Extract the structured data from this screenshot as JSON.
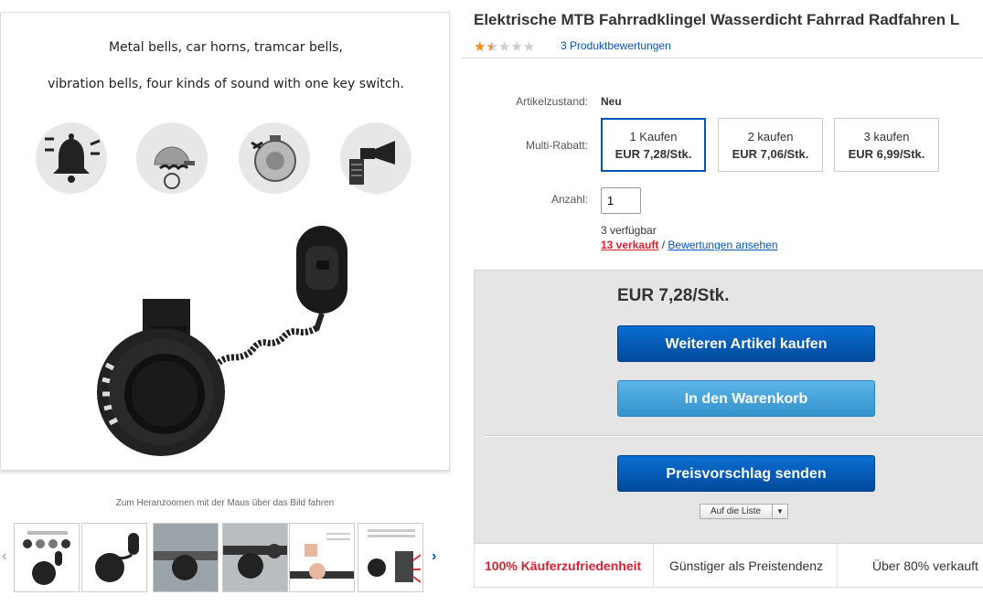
{
  "image_panel": {
    "caption_line1": "Metal bells, car horns, tramcar bells,",
    "caption_line2": "vibration bells, four kinds of sound with one key switch.",
    "zoom_hint": "Zum Heranzoomen mit der Maus über das Bild fahren",
    "thumbnail_count": 6
  },
  "product": {
    "title": "Elektrische MTB Fahrradklingel Wasserdicht Fahrrad Radfahren L",
    "rating_stars": 1.5,
    "rating_max": 5,
    "ratings_link": "3 Produktbewertungen"
  },
  "condition": {
    "label": "Artikelzustand:",
    "value": "Neu"
  },
  "multi_rabatt": {
    "label": "Multi-Rabatt:",
    "options": [
      {
        "qty": "1 Kaufen",
        "price": "EUR 7,28/Stk.",
        "selected": true
      },
      {
        "qty": "2 kaufen",
        "price": "EUR 7,06/Stk.",
        "selected": false
      },
      {
        "qty": "3 kaufen",
        "price": "EUR 6,99/Stk.",
        "selected": false
      }
    ]
  },
  "quantity": {
    "label": "Anzahl:",
    "value": "1",
    "available": "3 verfügbar",
    "sold": "13 verkauft",
    "separator": "/",
    "reviews_link": "Bewertungen ansehen"
  },
  "buybox": {
    "price": "EUR 7,28/Stk.",
    "buy_more": "Weiteren Artikel kaufen",
    "add_to_cart": "In den Warenkorb",
    "make_offer": "Preisvorschlag senden",
    "watch_label": "Auf die Liste"
  },
  "trust_bar": {
    "satisfaction": "100% Käuferzufriedenheit",
    "price_trend": "Günstiger als Preistendenz",
    "sold_percent": "Über 80% verkauft"
  },
  "colors": {
    "link_blue": "#0654ba",
    "sold_red": "#dd1e31",
    "button_dark": "#0a6ed1",
    "button_light": "#5bb6e8",
    "star_orange": "#f18a1e"
  }
}
